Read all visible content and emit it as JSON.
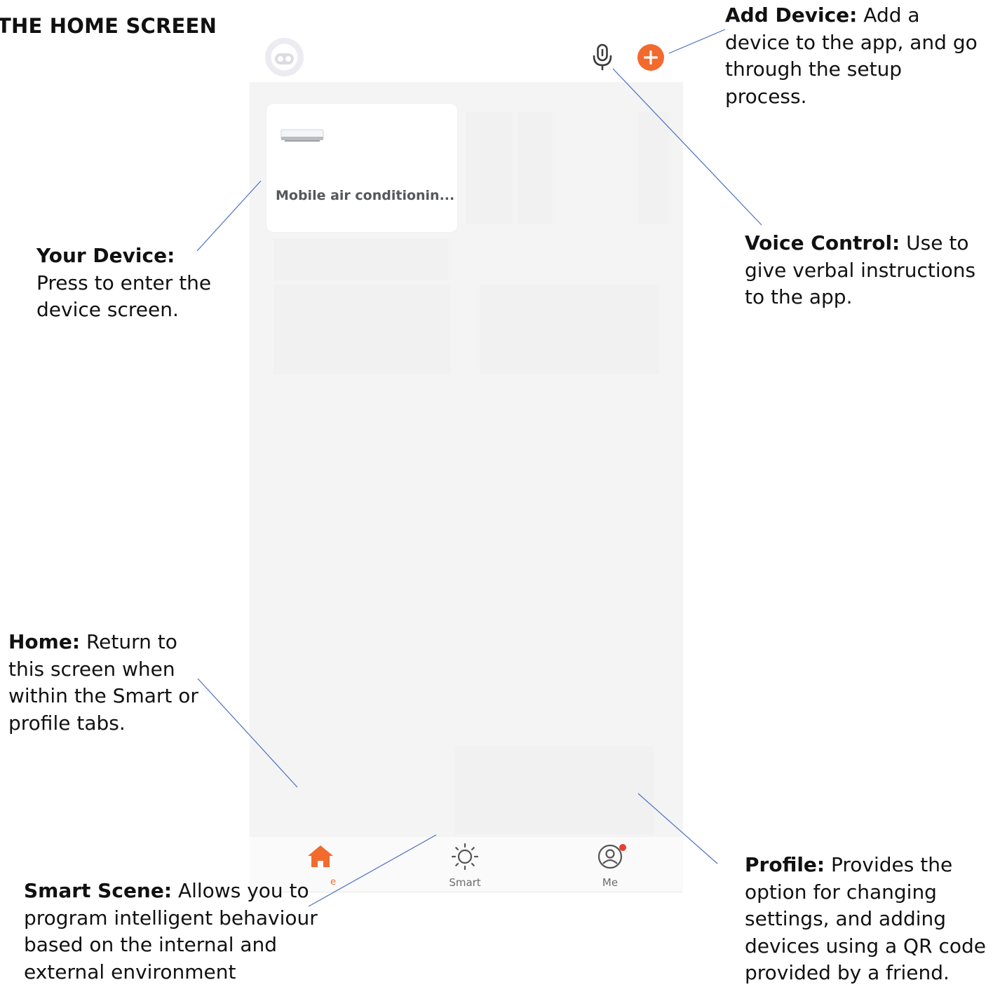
{
  "page_title": "THE HOME SCREEN",
  "colors": {
    "accent": "#f26a2e",
    "leader_line": "#4a6fc0",
    "screen_bg": "#f4f4f4",
    "badge": "#ee3b32"
  },
  "header": {
    "avatar_icon": "robot-avatar-icon",
    "mic_icon": "microphone-icon",
    "add_icon": "plus-circle-icon"
  },
  "device_card": {
    "name": "Mobile air conditionin...",
    "icon": "air-conditioner-icon"
  },
  "tabs": [
    {
      "label": "e",
      "icon": "home-icon",
      "active": true
    },
    {
      "label": "Smart",
      "icon": "sun-icon",
      "active": false
    },
    {
      "label": "Me",
      "icon": "profile-icon",
      "active": false
    }
  ],
  "annotations": {
    "add_device": {
      "title": "Add Device:",
      "lines": [
        " Add a",
        "device to the app, and go",
        "through the setup",
        "process."
      ]
    },
    "your_device": {
      "title": "Your Device:",
      "lines": [
        "Press to enter the",
        "device screen."
      ]
    },
    "voice_control": {
      "title": "Voice Control:",
      "lines": [
        " Use to",
        "give verbal instructions",
        "to the app."
      ]
    },
    "home": {
      "title": "Home:",
      "lines": [
        " Return to",
        "this screen when",
        "within the Smart or",
        "profile tabs."
      ]
    },
    "smart_scene": {
      "title": "Smart Scene:",
      "lines": [
        " Allows you to",
        "program intelligent behaviour",
        "based on the internal and",
        "external environment"
      ]
    },
    "profile": {
      "title": "Profile:",
      "lines": [
        " Provides the",
        "option for changing",
        "settings, and adding",
        "devices using a QR code",
        "provided by a friend."
      ]
    }
  }
}
